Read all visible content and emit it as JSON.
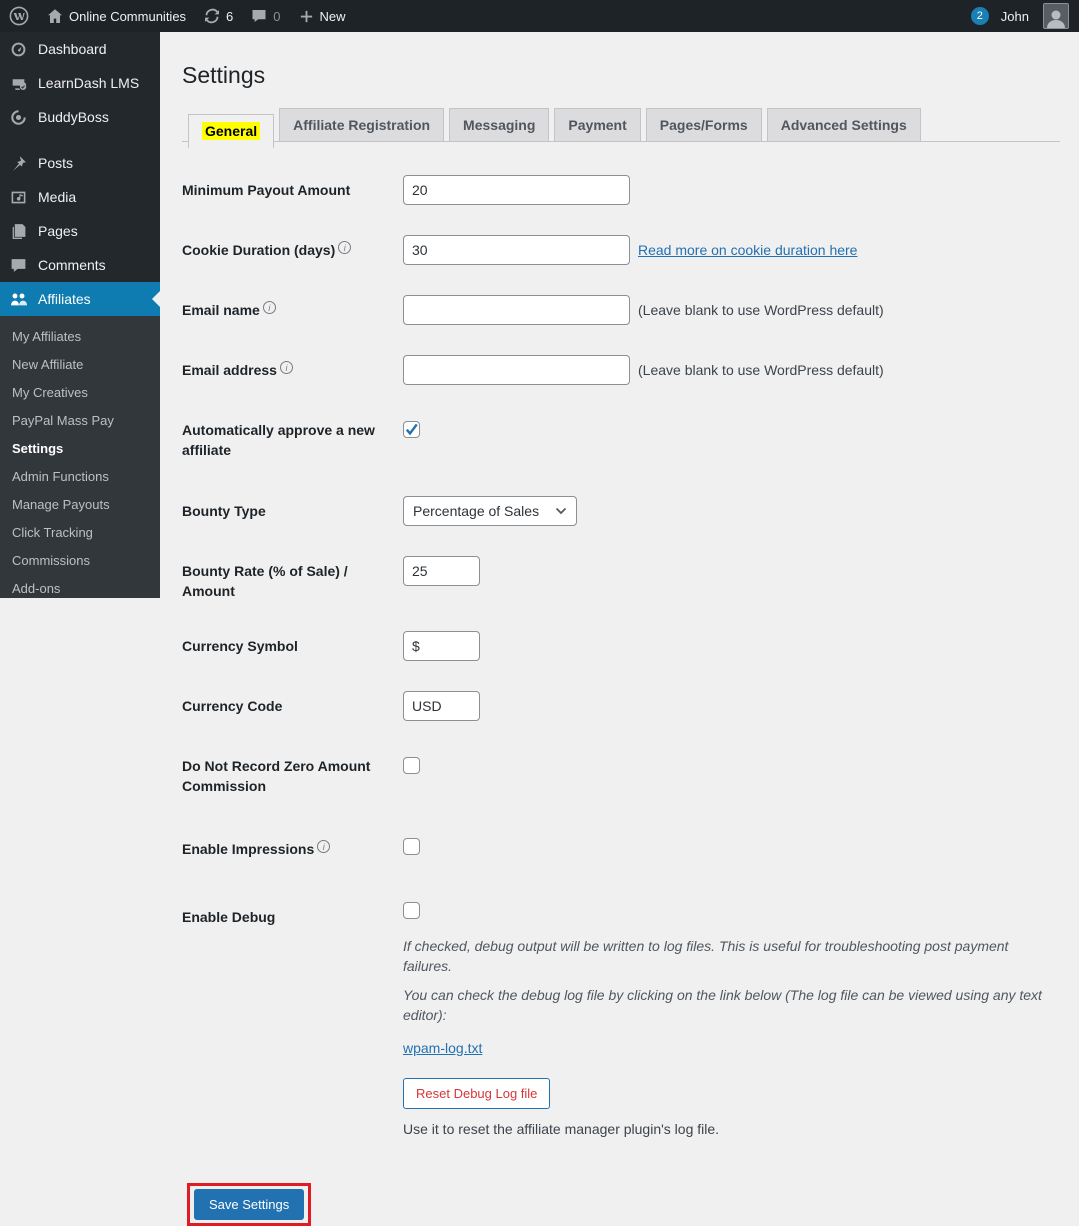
{
  "admin_bar": {
    "site_name": "Online Communities",
    "updates_count": "6",
    "comments_count": "0",
    "new_label": "New",
    "notification_count": "2",
    "username": "John"
  },
  "sidebar": {
    "items": [
      {
        "label": "Dashboard",
        "icon": "dashboard-icon"
      },
      {
        "label": "LearnDash LMS",
        "icon": "learndash-icon"
      },
      {
        "label": "BuddyBoss",
        "icon": "buddyboss-icon"
      },
      {
        "label": "Posts",
        "icon": "pin-icon"
      },
      {
        "label": "Media",
        "icon": "media-icon"
      },
      {
        "label": "Pages",
        "icon": "pages-icon"
      },
      {
        "label": "Comments",
        "icon": "comment-icon"
      },
      {
        "label": "Affiliates",
        "icon": "groups-icon",
        "active": true
      }
    ],
    "submenu": [
      "My Affiliates",
      "New Affiliate",
      "My Creatives",
      "PayPal Mass Pay",
      "Settings",
      "Admin Functions",
      "Manage Payouts",
      "Click Tracking",
      "Commissions",
      "Add-ons"
    ],
    "submenu_current": "Settings"
  },
  "main": {
    "title": "Settings",
    "tabs": [
      {
        "label": "General",
        "active": true,
        "highlighted": true
      },
      {
        "label": "Affiliate Registration"
      },
      {
        "label": "Messaging"
      },
      {
        "label": "Payment"
      },
      {
        "label": "Pages/Forms"
      },
      {
        "label": "Advanced Settings"
      }
    ],
    "rows": [
      {
        "label": "Minimum Payout Amount",
        "value": "20"
      },
      {
        "label": "Cookie Duration (days)",
        "info": true,
        "value": "30",
        "link": "Read more on cookie duration here"
      },
      {
        "label": "Email name",
        "info": true,
        "value": "",
        "note": "(Leave blank to use WordPress default)"
      },
      {
        "label": "Email address",
        "info": true,
        "value": "",
        "note": "(Leave blank to use WordPress default)"
      },
      {
        "label": "Automatically approve a new affiliate",
        "checked": true
      },
      {
        "label": "Bounty Type",
        "select_value": "Percentage of Sales"
      },
      {
        "label": "Bounty Rate (% of Sale) / Amount",
        "value": "25"
      },
      {
        "label": "Currency Symbol",
        "value": "$"
      },
      {
        "label": "Currency Code",
        "value": "USD"
      },
      {
        "label": "Do Not Record Zero Amount Commission",
        "checked": false
      },
      {
        "label": "Enable Impressions",
        "info": true,
        "checked": false
      },
      {
        "label": "Enable Debug",
        "checked": false,
        "desc1": "If checked, debug output will be written to log files. This is useful for troubleshooting post payment failures.",
        "desc2": "You can check the debug log file by clicking on the link below (The log file can be viewed using any text editor):",
        "log_link": "wpam-log.txt"
      }
    ],
    "reset": {
      "button_label": "Reset Debug Log file",
      "help": "Use it to reset the affiliate manager plugin's log file."
    },
    "save": {
      "button_label": "Save Settings"
    }
  },
  "colors": {
    "accent_blue": "#2271b1",
    "menu_active_blue": "#0e7cb0",
    "link_blue": "#2271b1",
    "danger_text_red": "#d63638",
    "annotation_red": "#e01b24",
    "annotation_yellow": "#ffff00",
    "admin_bar_bg": "#1d2327",
    "sidebar_bg": "#23282d",
    "submenu_bg": "#32373c",
    "page_bg": "#f0f0f1"
  }
}
